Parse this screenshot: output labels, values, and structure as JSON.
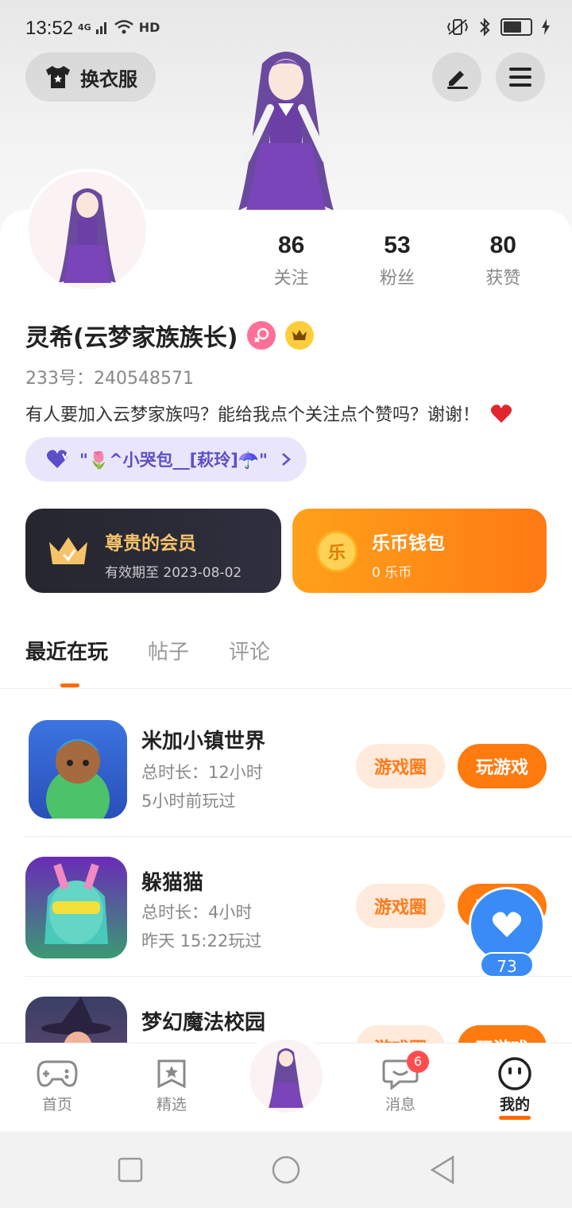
{
  "status_bar": {
    "time": "13:52",
    "network": "4G",
    "hd": "HD"
  },
  "header": {
    "outfit_label": "换衣服"
  },
  "stats": [
    {
      "value": "86",
      "label": "关注"
    },
    {
      "value": "53",
      "label": "粉丝"
    },
    {
      "value": "80",
      "label": "获赞"
    }
  ],
  "profile": {
    "name": "灵希(云梦家族族长)",
    "uid": "233号：240548571",
    "bio": "有人要加入云梦家族吗？能给我点个关注点个赞吗？谢谢！",
    "guard_text": "\"🌷^小哭包__[萩玲]☂️\""
  },
  "vip_card": {
    "title": "尊贵的会员",
    "subtitle": "有效期至 2023-08-02"
  },
  "coin_card": {
    "title": "乐币钱包",
    "subtitle": "0 乐币",
    "coin_glyph": "乐"
  },
  "tabs": [
    "最近在玩",
    "帖子",
    "评论"
  ],
  "games": [
    {
      "name": "米加小镇世界",
      "duration": "总时长：12小时",
      "last_played": "5小时前玩过",
      "circle_label": "游戏圈",
      "play_label": "玩游戏"
    },
    {
      "name": "躲猫猫",
      "duration": "总时长：4小时",
      "last_played": "昨天 15:22玩过",
      "circle_label": "游戏圈",
      "play_label": "玩游戏"
    },
    {
      "name": "梦幻魔法校园",
      "duration": "",
      "last_played": "",
      "circle_label": "游戏圈",
      "play_label": "玩游戏"
    }
  ],
  "like_float": {
    "count": "73"
  },
  "bottom_nav": [
    {
      "label": "首页",
      "icon": "gamepad-icon"
    },
    {
      "label": "精选",
      "icon": "star-bookmark-icon"
    },
    {
      "label": "消息",
      "icon": "chat-bubble-icon",
      "badge": "6"
    },
    {
      "label": "我的",
      "icon": "smile-face-icon"
    }
  ],
  "colors": {
    "accent": "#ff7a0f",
    "like_blue": "#3a8bf5",
    "vip_dark": "#26262f",
    "guard_purple": "#5b4fc9"
  }
}
